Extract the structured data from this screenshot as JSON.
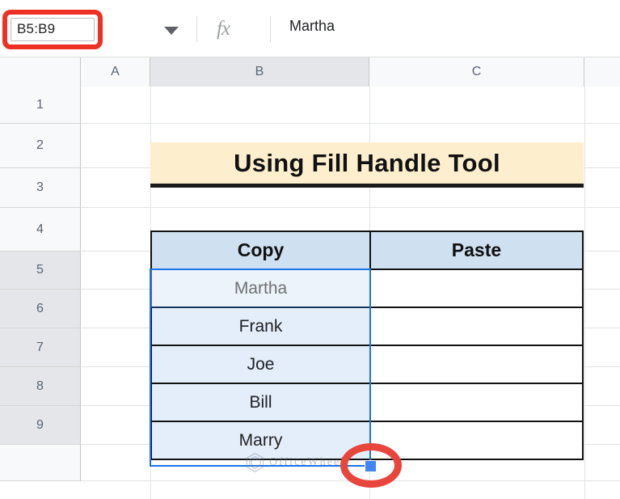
{
  "formula_bar": {
    "name_box_value": "B5:B9",
    "name_box_placeholder": "Name box",
    "dropdown_icon": "chevron-down-icon",
    "fx_label": "fx",
    "formula_value": "Martha"
  },
  "columns": [
    {
      "label": "A",
      "selected": false
    },
    {
      "label": "B",
      "selected": true
    },
    {
      "label": "C",
      "selected": false
    },
    {
      "label": "",
      "selected": false
    }
  ],
  "rows": [
    {
      "label": "1",
      "selected": false
    },
    {
      "label": "2",
      "selected": false
    },
    {
      "label": "3",
      "selected": false
    },
    {
      "label": "4",
      "selected": false
    },
    {
      "label": "5",
      "selected": true
    },
    {
      "label": "6",
      "selected": true
    },
    {
      "label": "7",
      "selected": true
    },
    {
      "label": "8",
      "selected": true
    },
    {
      "label": "9",
      "selected": true
    },
    {
      "label": "",
      "selected": false
    }
  ],
  "sheet": {
    "title_banner": "Using Fill Handle Tool",
    "table": {
      "headers": [
        "Copy",
        "Paste"
      ],
      "rows": [
        {
          "copy": "Martha",
          "paste": ""
        },
        {
          "copy": "Frank",
          "paste": ""
        },
        {
          "copy": "Joe",
          "paste": ""
        },
        {
          "copy": "Bill",
          "paste": ""
        },
        {
          "copy": "Marry",
          "paste": ""
        }
      ]
    }
  },
  "annotations": {
    "name_box_highlight_color": "#ee3124",
    "fill_handle_highlight_color": "#e8453c",
    "fill_handle_name": "fill-handle"
  },
  "watermark": {
    "text": "OfficeWheel",
    "logo_icon": "hexagon-logo-icon"
  },
  "colors": {
    "selection_blue": "#1a73e8",
    "header_blue": "#cfe0f0",
    "selected_cell_blue": "#e4eefa",
    "title_cream": "#fdeecd",
    "header_gray": "#f8f9fa",
    "header_gray_selected": "#e4e6e9"
  }
}
